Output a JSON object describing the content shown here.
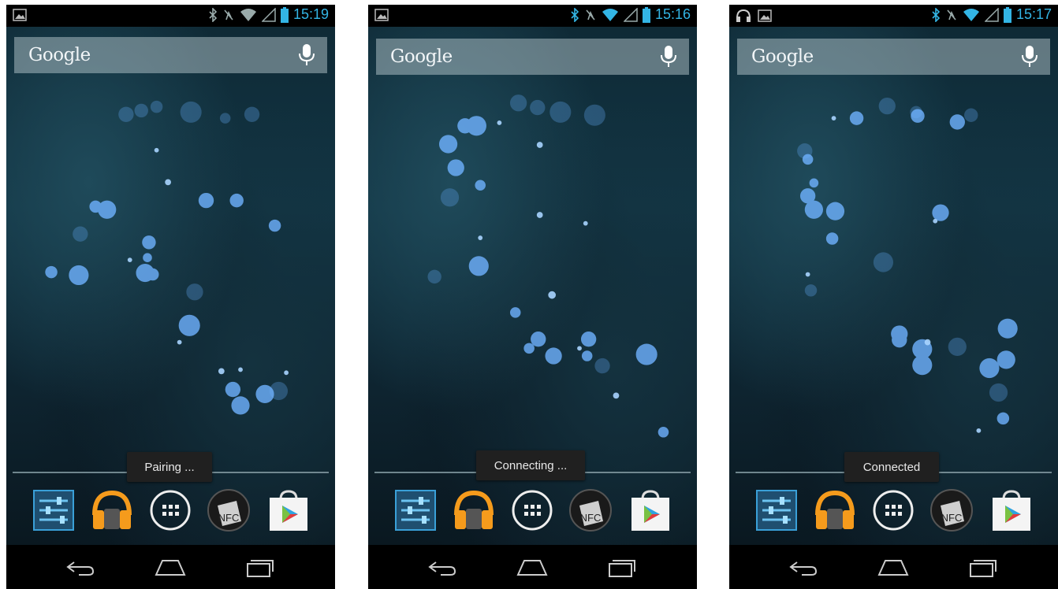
{
  "phones": [
    {
      "id": "phone-1",
      "status": {
        "time": "15:19",
        "left_icons": [
          "image-icon"
        ],
        "right_icons": [
          "bluetooth-icon",
          "vibrate-icon",
          "wifi-icon",
          "signal-icon",
          "battery-icon"
        ]
      },
      "search": {
        "logo": "Google"
      },
      "toast": "Pairing ...",
      "dock": [
        "settings-app-icon",
        "music-app-icon",
        "app-drawer-icon",
        "nfc-app-icon",
        "play-store-icon"
      ],
      "nfc_label": "NFC"
    },
    {
      "id": "phone-2",
      "status": {
        "time": "15:16",
        "left_icons": [
          "image-icon"
        ],
        "right_icons": [
          "bluetooth-icon",
          "vibrate-icon",
          "wifi-icon",
          "signal-icon",
          "battery-icon"
        ]
      },
      "search": {
        "logo": "Google"
      },
      "toast": "Connecting ...",
      "dock": [
        "settings-app-icon",
        "music-app-icon",
        "app-drawer-icon",
        "nfc-app-icon",
        "play-store-icon"
      ],
      "nfc_label": "NFC"
    },
    {
      "id": "phone-3",
      "status": {
        "time": "15:17",
        "left_icons": [
          "headphones-icon",
          "image-icon"
        ],
        "right_icons": [
          "bluetooth-icon",
          "vibrate-icon",
          "wifi-icon",
          "signal-icon",
          "battery-icon"
        ]
      },
      "search": {
        "logo": "Google"
      },
      "toast": "Connected",
      "dock": [
        "settings-app-icon",
        "music-app-icon",
        "app-drawer-icon",
        "nfc-app-icon",
        "play-store-icon"
      ],
      "nfc_label": "NFC"
    }
  ],
  "colors": {
    "accent": "#33b5e5",
    "toast_bg": "#202020",
    "wallpaper": "#123544"
  }
}
